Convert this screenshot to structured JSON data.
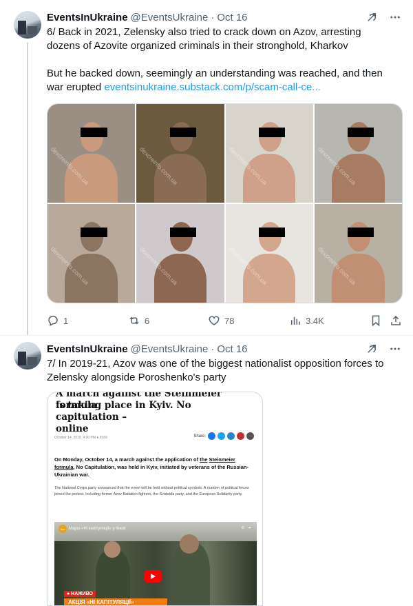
{
  "tweets": [
    {
      "author_name": "EventsInUkraine",
      "handle": "@EventsUkraine",
      "separator": "·",
      "date": "Oct 16",
      "text_lines": [
        "6/ Back in 2021, Zelensky also tried to crack down on Azov, arresting",
        "dozens of Azovite organized criminals in their stronghold, Kharkov"
      ],
      "text_para2": "But he backed down, seemingly an understanding was reached, and then",
      "text_para2_line2_prefix": "war erupted ",
      "link": "eventsinukraine.substack.com/p/scam-call-ce...",
      "media": {
        "watermark": "dexcreinfo.com.ua",
        "photos": [
          {
            "bg": "#9a8f82",
            "skin": "#c99a7e",
            "bar": "#000"
          },
          {
            "bg": "#6b5a3e",
            "skin": "#8a6c55",
            "bar": "#000"
          },
          {
            "bg": "#d9d4ca",
            "skin": "#d0a18a",
            "bar": "#000"
          },
          {
            "bg": "#b8b6b0",
            "skin": "#a77c62",
            "bar": "#000"
          },
          {
            "bg": "#b9a99a",
            "skin": "#8b7561",
            "bar": "#000"
          },
          {
            "bg": "#cfc9cc",
            "skin": "#8d6751",
            "bar": "#000"
          },
          {
            "bg": "#e8e4df",
            "skin": "#d3a68e",
            "bar": "#000"
          },
          {
            "bg": "#b7b0a3",
            "skin": "#c18f74",
            "bar": "#000"
          }
        ]
      },
      "actions": {
        "replies": "1",
        "reposts": "6",
        "likes": "78",
        "views": "3.4K"
      }
    },
    {
      "author_name": "EventsInUkraine",
      "handle": "@EventsUkraine",
      "separator": "·",
      "date": "Oct 16",
      "text_lines": [
        "7/ In 2019-21, Azov was one of the biggest nationalist opposition forces to",
        "Zelensky alongside Poroshenko's party"
      ],
      "article": {
        "title_cut": "A march against the Steinmeier formula",
        "title_line2": "is taking place in Kyiv. No capitulation –",
        "title_line3": "online",
        "meta": "October 14, 2019, 4:00 PM   ●  8169",
        "share_label": "Share:",
        "share_colors": [
          "#1877f2",
          "#1da1f2",
          "#2a87c7",
          "#c4302b",
          "#555555"
        ],
        "lead_prefix": "On Monday, October 14, a march against the application of ",
        "lead_link1": "the",
        "lead_link2": "Steinmeier formula",
        "lead_suffix": ", No Capitulation, was held in Kyiv, initiated by veterans of the Russian-Ukrainian war.",
        "body": "The National Corps party announced that the event will be held without political symbols. A number of political forces joined the protest, including former Azov Battalion fighters, the Svoboda party, and the European Solidarity party.",
        "video": {
          "title": "Марш «Ні капітуляції» у Києві",
          "logo": "hro",
          "live_tag": "● НАЖИВО",
          "banner": "АКЦІЯ «НІ КАПІТУЛЯЦІЇ»"
        }
      }
    }
  ],
  "colors": {
    "link": "#1d9bf0",
    "secondary_text": "#536471",
    "thread_line": "#cfd9de"
  }
}
